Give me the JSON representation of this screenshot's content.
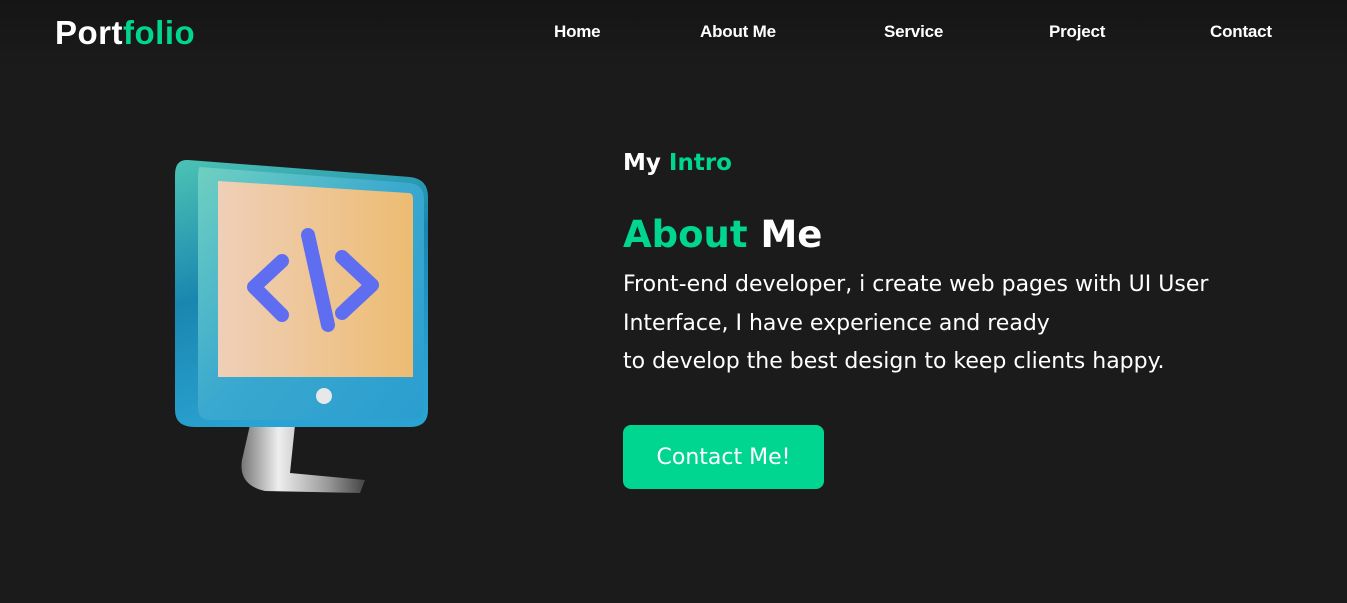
{
  "header": {
    "logo_main": "Port",
    "logo_accent": "folio",
    "nav": [
      "Home",
      "About Me",
      "Service",
      "Project",
      "Contact"
    ]
  },
  "hero": {
    "subtitle_plain": "My",
    "subtitle_accent": "Intro",
    "title_accent": "About",
    "title_plain": "Me",
    "description_lines": [
      "Front-end developer, i create web pages with UI User",
      "Interface, I have experience and ready",
      "to develop the best design to keep clients happy."
    ],
    "cta_label": "Contact Me!",
    "illustration_icon": "computer-monitor-code-icon"
  },
  "colors": {
    "accent": "#00d68f",
    "background": "#1b1b1b",
    "text": "#ffffff"
  }
}
